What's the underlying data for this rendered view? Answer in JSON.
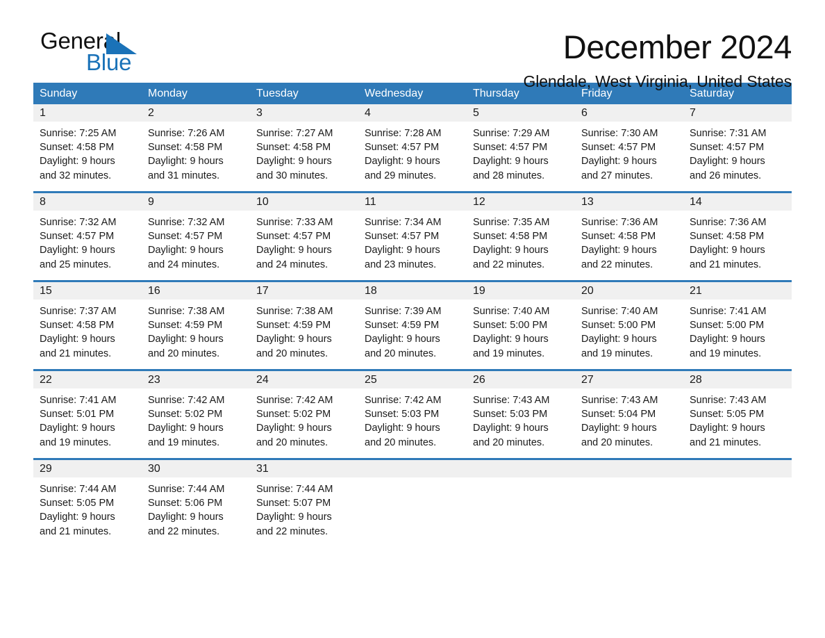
{
  "brand": {
    "word1": "General",
    "word2": "Blue",
    "triangle_color": "#1a72b8",
    "logo_icon": "general-blue-triangle-logo"
  },
  "header": {
    "title": "December 2024",
    "location": "Glendale, West Virginia, United States"
  },
  "colors": {
    "header_blue": "#2f7ab8",
    "row_divider_blue": "#2f7ab8",
    "day_band_gray": "#f0f0f0",
    "text": "#1a1a1a"
  },
  "weekdays": [
    "Sunday",
    "Monday",
    "Tuesday",
    "Wednesday",
    "Thursday",
    "Friday",
    "Saturday"
  ],
  "weeks": [
    [
      {
        "day": "1",
        "sunrise": "Sunrise: 7:25 AM",
        "sunset": "Sunset: 4:58 PM",
        "daylight1": "Daylight: 9 hours",
        "daylight2": "and 32 minutes."
      },
      {
        "day": "2",
        "sunrise": "Sunrise: 7:26 AM",
        "sunset": "Sunset: 4:58 PM",
        "daylight1": "Daylight: 9 hours",
        "daylight2": "and 31 minutes."
      },
      {
        "day": "3",
        "sunrise": "Sunrise: 7:27 AM",
        "sunset": "Sunset: 4:58 PM",
        "daylight1": "Daylight: 9 hours",
        "daylight2": "and 30 minutes."
      },
      {
        "day": "4",
        "sunrise": "Sunrise: 7:28 AM",
        "sunset": "Sunset: 4:57 PM",
        "daylight1": "Daylight: 9 hours",
        "daylight2": "and 29 minutes."
      },
      {
        "day": "5",
        "sunrise": "Sunrise: 7:29 AM",
        "sunset": "Sunset: 4:57 PM",
        "daylight1": "Daylight: 9 hours",
        "daylight2": "and 28 minutes."
      },
      {
        "day": "6",
        "sunrise": "Sunrise: 7:30 AM",
        "sunset": "Sunset: 4:57 PM",
        "daylight1": "Daylight: 9 hours",
        "daylight2": "and 27 minutes."
      },
      {
        "day": "7",
        "sunrise": "Sunrise: 7:31 AM",
        "sunset": "Sunset: 4:57 PM",
        "daylight1": "Daylight: 9 hours",
        "daylight2": "and 26 minutes."
      }
    ],
    [
      {
        "day": "8",
        "sunrise": "Sunrise: 7:32 AM",
        "sunset": "Sunset: 4:57 PM",
        "daylight1": "Daylight: 9 hours",
        "daylight2": "and 25 minutes."
      },
      {
        "day": "9",
        "sunrise": "Sunrise: 7:32 AM",
        "sunset": "Sunset: 4:57 PM",
        "daylight1": "Daylight: 9 hours",
        "daylight2": "and 24 minutes."
      },
      {
        "day": "10",
        "sunrise": "Sunrise: 7:33 AM",
        "sunset": "Sunset: 4:57 PM",
        "daylight1": "Daylight: 9 hours",
        "daylight2": "and 24 minutes."
      },
      {
        "day": "11",
        "sunrise": "Sunrise: 7:34 AM",
        "sunset": "Sunset: 4:57 PM",
        "daylight1": "Daylight: 9 hours",
        "daylight2": "and 23 minutes."
      },
      {
        "day": "12",
        "sunrise": "Sunrise: 7:35 AM",
        "sunset": "Sunset: 4:58 PM",
        "daylight1": "Daylight: 9 hours",
        "daylight2": "and 22 minutes."
      },
      {
        "day": "13",
        "sunrise": "Sunrise: 7:36 AM",
        "sunset": "Sunset: 4:58 PM",
        "daylight1": "Daylight: 9 hours",
        "daylight2": "and 22 minutes."
      },
      {
        "day": "14",
        "sunrise": "Sunrise: 7:36 AM",
        "sunset": "Sunset: 4:58 PM",
        "daylight1": "Daylight: 9 hours",
        "daylight2": "and 21 minutes."
      }
    ],
    [
      {
        "day": "15",
        "sunrise": "Sunrise: 7:37 AM",
        "sunset": "Sunset: 4:58 PM",
        "daylight1": "Daylight: 9 hours",
        "daylight2": "and 21 minutes."
      },
      {
        "day": "16",
        "sunrise": "Sunrise: 7:38 AM",
        "sunset": "Sunset: 4:59 PM",
        "daylight1": "Daylight: 9 hours",
        "daylight2": "and 20 minutes."
      },
      {
        "day": "17",
        "sunrise": "Sunrise: 7:38 AM",
        "sunset": "Sunset: 4:59 PM",
        "daylight1": "Daylight: 9 hours",
        "daylight2": "and 20 minutes."
      },
      {
        "day": "18",
        "sunrise": "Sunrise: 7:39 AM",
        "sunset": "Sunset: 4:59 PM",
        "daylight1": "Daylight: 9 hours",
        "daylight2": "and 20 minutes."
      },
      {
        "day": "19",
        "sunrise": "Sunrise: 7:40 AM",
        "sunset": "Sunset: 5:00 PM",
        "daylight1": "Daylight: 9 hours",
        "daylight2": "and 19 minutes."
      },
      {
        "day": "20",
        "sunrise": "Sunrise: 7:40 AM",
        "sunset": "Sunset: 5:00 PM",
        "daylight1": "Daylight: 9 hours",
        "daylight2": "and 19 minutes."
      },
      {
        "day": "21",
        "sunrise": "Sunrise: 7:41 AM",
        "sunset": "Sunset: 5:00 PM",
        "daylight1": "Daylight: 9 hours",
        "daylight2": "and 19 minutes."
      }
    ],
    [
      {
        "day": "22",
        "sunrise": "Sunrise: 7:41 AM",
        "sunset": "Sunset: 5:01 PM",
        "daylight1": "Daylight: 9 hours",
        "daylight2": "and 19 minutes."
      },
      {
        "day": "23",
        "sunrise": "Sunrise: 7:42 AM",
        "sunset": "Sunset: 5:02 PM",
        "daylight1": "Daylight: 9 hours",
        "daylight2": "and 19 minutes."
      },
      {
        "day": "24",
        "sunrise": "Sunrise: 7:42 AM",
        "sunset": "Sunset: 5:02 PM",
        "daylight1": "Daylight: 9 hours",
        "daylight2": "and 20 minutes."
      },
      {
        "day": "25",
        "sunrise": "Sunrise: 7:42 AM",
        "sunset": "Sunset: 5:03 PM",
        "daylight1": "Daylight: 9 hours",
        "daylight2": "and 20 minutes."
      },
      {
        "day": "26",
        "sunrise": "Sunrise: 7:43 AM",
        "sunset": "Sunset: 5:03 PM",
        "daylight1": "Daylight: 9 hours",
        "daylight2": "and 20 minutes."
      },
      {
        "day": "27",
        "sunrise": "Sunrise: 7:43 AM",
        "sunset": "Sunset: 5:04 PM",
        "daylight1": "Daylight: 9 hours",
        "daylight2": "and 20 minutes."
      },
      {
        "day": "28",
        "sunrise": "Sunrise: 7:43 AM",
        "sunset": "Sunset: 5:05 PM",
        "daylight1": "Daylight: 9 hours",
        "daylight2": "and 21 minutes."
      }
    ],
    [
      {
        "day": "29",
        "sunrise": "Sunrise: 7:44 AM",
        "sunset": "Sunset: 5:05 PM",
        "daylight1": "Daylight: 9 hours",
        "daylight2": "and 21 minutes."
      },
      {
        "day": "30",
        "sunrise": "Sunrise: 7:44 AM",
        "sunset": "Sunset: 5:06 PM",
        "daylight1": "Daylight: 9 hours",
        "daylight2": "and 22 minutes."
      },
      {
        "day": "31",
        "sunrise": "Sunrise: 7:44 AM",
        "sunset": "Sunset: 5:07 PM",
        "daylight1": "Daylight: 9 hours",
        "daylight2": "and 22 minutes."
      },
      {
        "day": "",
        "sunrise": "",
        "sunset": "",
        "daylight1": "",
        "daylight2": ""
      },
      {
        "day": "",
        "sunrise": "",
        "sunset": "",
        "daylight1": "",
        "daylight2": ""
      },
      {
        "day": "",
        "sunrise": "",
        "sunset": "",
        "daylight1": "",
        "daylight2": ""
      },
      {
        "day": "",
        "sunrise": "",
        "sunset": "",
        "daylight1": "",
        "daylight2": ""
      }
    ]
  ]
}
